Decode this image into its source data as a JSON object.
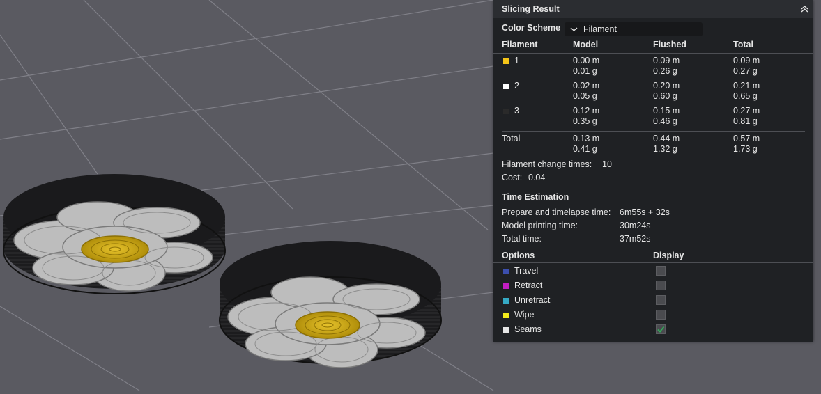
{
  "panel": {
    "title": "Slicing Result",
    "color_scheme_label": "Color Scheme",
    "color_scheme_value": "Filament"
  },
  "filament_table": {
    "headers": [
      "Filament",
      "Model",
      "Flushed",
      "Total"
    ],
    "rows": [
      {
        "label": "1",
        "color": "#f5c518",
        "model_m": "0.00 m",
        "model_g": "0.01 g",
        "flushed_m": "0.09 m",
        "flushed_g": "0.26 g",
        "total_m": "0.09 m",
        "total_g": "0.27 g"
      },
      {
        "label": "2",
        "color": "#ffffff",
        "model_m": "0.02 m",
        "model_g": "0.05 g",
        "flushed_m": "0.20 m",
        "flushed_g": "0.60 g",
        "total_m": "0.21 m",
        "total_g": "0.65 g"
      },
      {
        "label": "3",
        "color": "#2a2a2a",
        "model_m": "0.12 m",
        "model_g": "0.35 g",
        "flushed_m": "0.15 m",
        "flushed_g": "0.46 g",
        "total_m": "0.27 m",
        "total_g": "0.81 g"
      }
    ],
    "total": {
      "label": "Total",
      "model_m": "0.13 m",
      "model_g": "0.41 g",
      "flushed_m": "0.44 m",
      "flushed_g": "1.32 g",
      "total_m": "0.57 m",
      "total_g": "1.73 g"
    }
  },
  "filament_change": {
    "label": "Filament change times:",
    "value": "10"
  },
  "cost": {
    "label": "Cost:",
    "value": "0.04"
  },
  "time_estimation": {
    "title": "Time Estimation",
    "prepare_label": "Prepare and timelapse time:",
    "prepare_value": "6m55s + 32s",
    "model_label": "Model printing time:",
    "model_value": "30m24s",
    "total_label": "Total time:",
    "total_value": "37m52s"
  },
  "options": {
    "title": "Options",
    "display_label": "Display",
    "items": [
      {
        "label": "Travel",
        "color": "#3c4fae",
        "checked": false
      },
      {
        "label": "Retract",
        "color": "#c31ec3",
        "checked": false
      },
      {
        "label": "Unretract",
        "color": "#35a9c4",
        "checked": false
      },
      {
        "label": "Wipe",
        "color": "#f2ea1c",
        "checked": false
      },
      {
        "label": "Seams",
        "color": "#e6e6e6",
        "checked": true
      }
    ]
  },
  "icons": {
    "collapse": "double-chevron-up-icon",
    "dropdown": "chevron-down-icon",
    "check": "check-icon"
  },
  "colors": {
    "panel_bg": "#1f2124",
    "viewport_bg": "#5a5a61",
    "check_green": "#2fb35a",
    "flower_yellow": "#c9a50e"
  }
}
